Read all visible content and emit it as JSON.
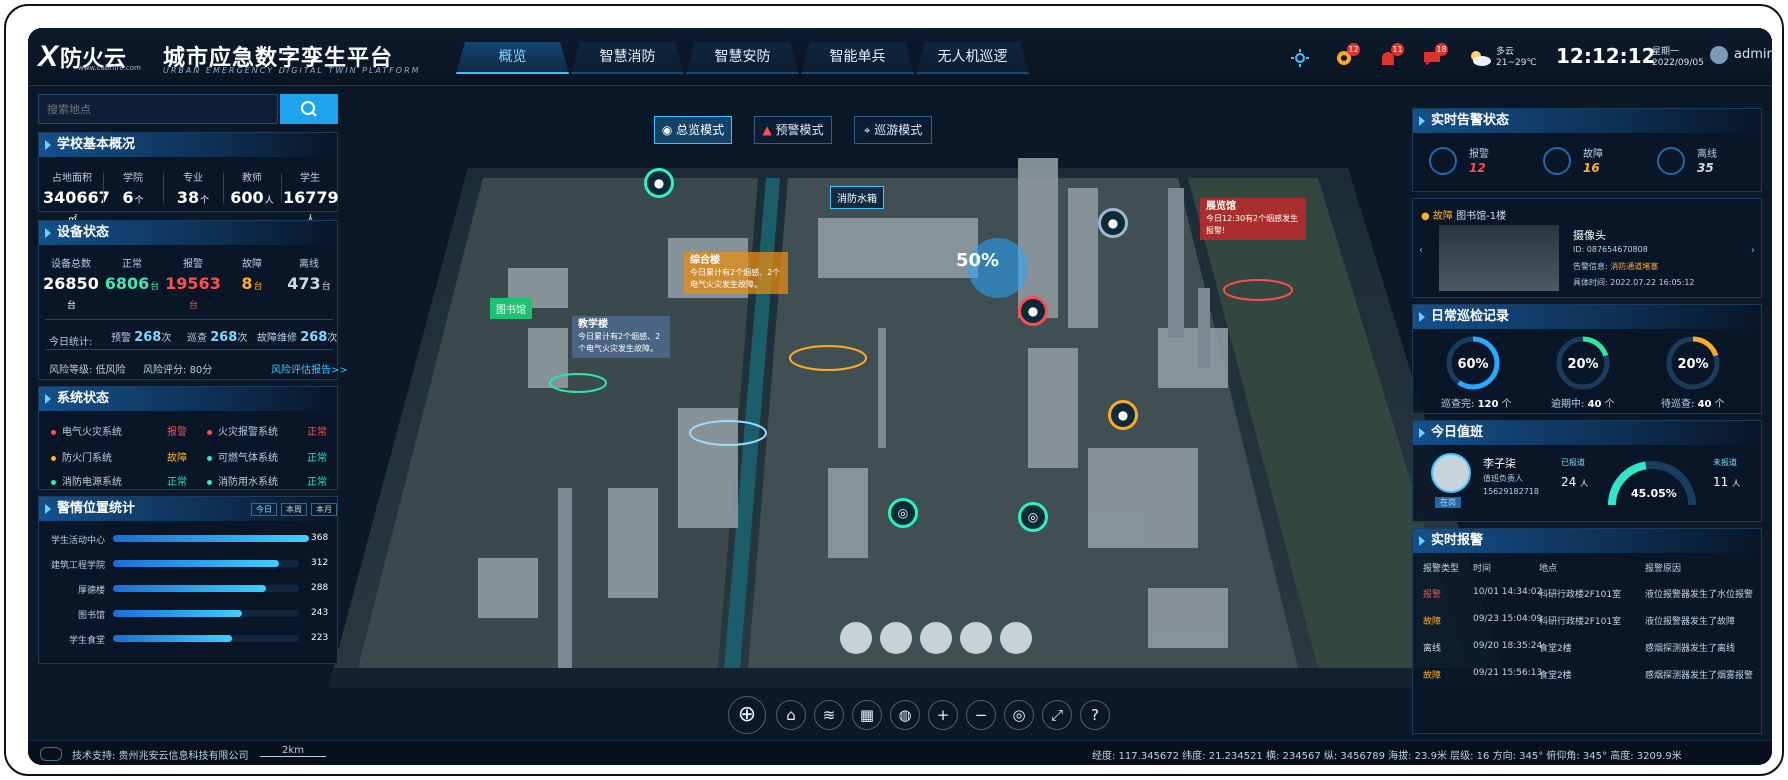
{
  "header": {
    "logo_mark": "X",
    "logo_name": "防火云",
    "logo_url": "www.cabrfire.com",
    "title": "城市应急数字孪生平台",
    "title_en": "URBAN EMERGENCY DIGITAL TWIN PLATFORM",
    "nav": [
      "概览",
      "智慧消防",
      "智慧安防",
      "智能单兵",
      "无人机巡逻"
    ],
    "active_nav": 0,
    "badges": [
      "12",
      "11",
      "18"
    ],
    "weather_main": "多云",
    "weather_temp": "21~29℃",
    "time": "12:12:12",
    "weekday": "星期一",
    "date": "2022/09/05",
    "user": "admin"
  },
  "search": {
    "placeholder": "搜索地点"
  },
  "school": {
    "title": "学校基本概况",
    "items": [
      {
        "label": "占地面积",
        "value": "340667",
        "unit": "㎡"
      },
      {
        "label": "学院",
        "value": "6",
        "unit": "个"
      },
      {
        "label": "专业",
        "value": "38",
        "unit": "个"
      },
      {
        "label": "教师",
        "value": "600",
        "unit": "人"
      },
      {
        "label": "学生",
        "value": "16779",
        "unit": "人"
      }
    ]
  },
  "device": {
    "title": "设备状态",
    "items": [
      {
        "label": "设备总数",
        "value": "26850",
        "unit": "台",
        "color": "#ffffff"
      },
      {
        "label": "正常",
        "value": "6806",
        "unit": "台",
        "color": "#42e6b0"
      },
      {
        "label": "报警",
        "value": "19563",
        "unit": "台",
        "color": "#ff4d4f"
      },
      {
        "label": "故障",
        "value": "8",
        "unit": "台",
        "color": "#ffb020"
      },
      {
        "label": "离线",
        "value": "473",
        "unit": "台",
        "color": "#cfd8e0"
      }
    ],
    "today_label": "今日统计:",
    "warn_label": "预警",
    "warn_val": "268",
    "patrol_label": "巡查",
    "patrol_val": "268",
    "repair_label": "故障维修",
    "repair_val": "268",
    "unit": "次",
    "risk_level_label": "风险等级:",
    "risk_level": "低风险",
    "risk_score_label": "风险评分:",
    "risk_score": "80分",
    "risk_link": "风险评估报告>>"
  },
  "system": {
    "title": "系统状态",
    "items": [
      {
        "name": "电气火灾系统",
        "status": "报警",
        "color": "#ff4d4f"
      },
      {
        "name": "火灾报警系统",
        "status": "正常",
        "color": "#ff4d4f"
      },
      {
        "name": "防火门系统",
        "status": "故障",
        "color": "#ffb020"
      },
      {
        "name": "可燃气体系统",
        "status": "正常",
        "color": "#2ee6c8"
      },
      {
        "name": "消防电源系统",
        "status": "正常",
        "color": "#2ee6c8"
      },
      {
        "name": "消防用水系统",
        "status": "正常",
        "color": "#2ee6c8"
      }
    ]
  },
  "police": {
    "title": "警情位置统计",
    "tabs": [
      "今日",
      "本周",
      "本月"
    ],
    "chart_data": {
      "type": "bar",
      "categories": [
        "学生活动中心",
        "建筑工程学院",
        "厚德楼",
        "图书馆",
        "学生食堂"
      ],
      "values": [
        368,
        312,
        288,
        243,
        223
      ],
      "xlim": [
        0,
        420
      ]
    }
  },
  "map": {
    "modes": [
      "总览模式",
      "预警模式",
      "巡游模式"
    ],
    "labels": {
      "water": "消防水箱",
      "water_pct": "50%",
      "library": "图书馆",
      "teach": "教学楼",
      "teach_note": "今日累计有2个烟感、2个电气火灾发生故障。",
      "comp": "综合楼",
      "comp_note": "今日累计有2个烟感、2个电气火灾发生故障。",
      "exhibit": "展览馆",
      "exhibit_note": "今日12:30有2个烟感发生报警!"
    },
    "tools": [
      "home-icon",
      "layers-icon",
      "grid-icon",
      "globe-icon",
      "zoom-in-icon",
      "zoom-out-icon",
      "earth-icon",
      "fullscreen-icon",
      "help-icon"
    ]
  },
  "alarm_status": {
    "title": "实时告警状态",
    "items": [
      {
        "label": "报警",
        "value": "12",
        "color": "#ff4d4f"
      },
      {
        "label": "故障",
        "value": "16",
        "color": "#ffb020"
      },
      {
        "label": "离线",
        "value": "35",
        "color": "#cfd8e0"
      }
    ]
  },
  "fault": {
    "tag": "故障",
    "location": "图书馆-1楼",
    "device": "摄像头",
    "id": "ID: 087654670808",
    "info_label": "告警信息:",
    "info": "消防通道堵塞",
    "time": "具体时间: 2022.07.22 16:05:12"
  },
  "inspection": {
    "title": "日常巡检记录",
    "items": [
      {
        "pct": 60,
        "label": "巡查完:",
        "value": "120",
        "unit": "个",
        "color": "#2aa8ff"
      },
      {
        "pct": 20,
        "label": "逾期中:",
        "value": "40",
        "unit": "个",
        "color": "#2ee6a0"
      },
      {
        "pct": 20,
        "label": "待巡查:",
        "value": "40",
        "unit": "个",
        "color": "#ffa826"
      }
    ]
  },
  "duty": {
    "title": "今日值班",
    "name": "李子柒",
    "role": "值班负责人",
    "phone": "15629182718",
    "tag": "在岗",
    "arrived_label": "已报道",
    "arrived": "24",
    "arrived_unit": "人",
    "absent_label": "未报道",
    "absent": "11",
    "absent_unit": "人",
    "pct": 45.05,
    "pct_text": "45.05"
  },
  "alarms": {
    "title": "实时报警",
    "headers": [
      "报警类型",
      "时间",
      "地点",
      "报警原因"
    ],
    "rows": [
      {
        "type": "报警",
        "color": "#ff4d4f",
        "time": "10/01 14:34:02",
        "place": "科研行政楼2F101室",
        "reason": "液位报警器发生了水位报警"
      },
      {
        "type": "故障",
        "color": "#ffb020",
        "time": "09/23 15:04:09",
        "place": "科研行政楼2F101室",
        "reason": "液位报警器发生了故障"
      },
      {
        "type": "离线",
        "color": "#cfd8e0",
        "time": "09/20 18:35:24",
        "place": "食堂2楼",
        "reason": "感烟探测器发生了离线"
      },
      {
        "type": "故障",
        "color": "#ffb020",
        "time": "09/21 15:56:13",
        "place": "食堂2楼",
        "reason": "感烟探测器发生了烟雾报警"
      }
    ]
  },
  "footer": {
    "support": "技术支持: 贵州兆安云信息科技有限公司",
    "scale": "2km",
    "coords": "经度: 117.345672   纬度: 21.234521   横: 234567   纵: 3456789   海拔: 23.9米   层级: 16   方向: 345°   俯仰角: 345°   高度: 3209.9米"
  }
}
